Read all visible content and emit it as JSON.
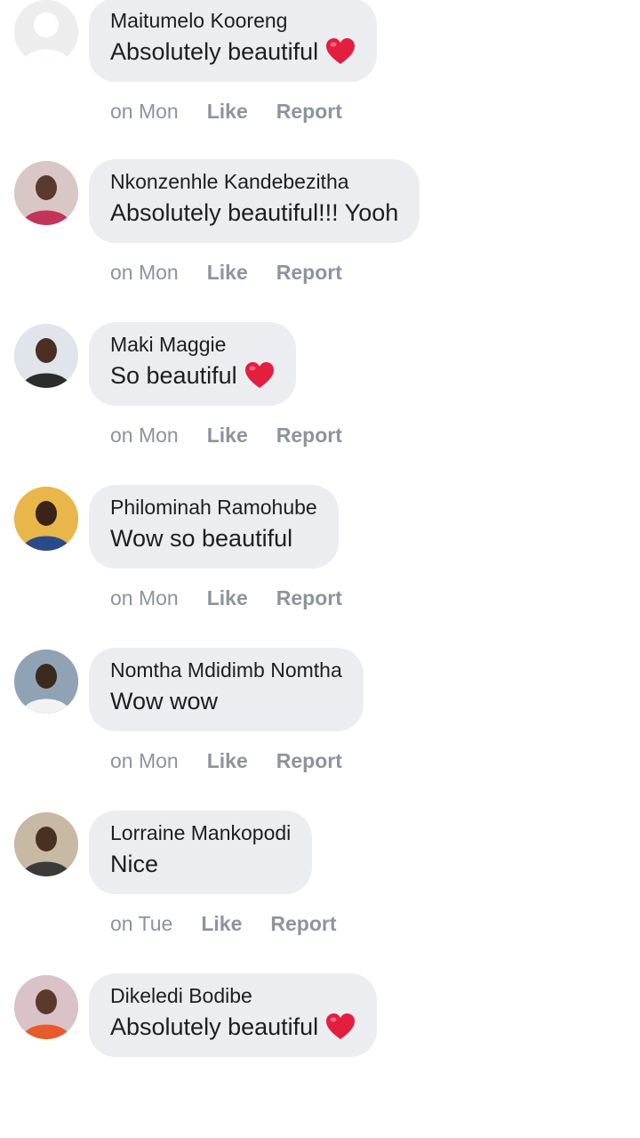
{
  "colors": {
    "bubble": "#ebedf0",
    "text": "#1c1e21",
    "meta": "#8d949e",
    "heart": "#e41e3f"
  },
  "comments": [
    {
      "author": "Maitumelo Kooreng",
      "text": "Absolutely beautiful",
      "heart": true,
      "time": "on Mon",
      "like": "Like",
      "report": "Report",
      "avatar": "default-avatar"
    },
    {
      "author": "Nkonzenhle Kandebezitha",
      "text": "Absolutely beautiful!!! Yooh",
      "heart": false,
      "time": "on Mon",
      "like": "Like",
      "report": "Report",
      "avatar": "user-photo"
    },
    {
      "author": "Maki Maggie",
      "text": "So beautiful",
      "heart": true,
      "time": "on Mon",
      "like": "Like",
      "report": "Report",
      "avatar": "user-photo"
    },
    {
      "author": "Philominah Ramohube",
      "text": "Wow so beautiful",
      "heart": false,
      "time": "on Mon",
      "like": "Like",
      "report": "Report",
      "avatar": "user-photo"
    },
    {
      "author": "Nomtha Mdidimb Nomtha",
      "text": "Wow wow",
      "heart": false,
      "time": "on Mon",
      "like": "Like",
      "report": "Report",
      "avatar": "user-photo"
    },
    {
      "author": "Lorraine Mankopodi",
      "text": "Nice",
      "heart": false,
      "time": "on Tue",
      "like": "Like",
      "report": "Report",
      "avatar": "user-photo"
    },
    {
      "author": "Dikeledi Bodibe",
      "text": "Absolutely beautiful",
      "heart": true,
      "time": "",
      "like": "",
      "report": "",
      "avatar": "user-photo"
    }
  ]
}
